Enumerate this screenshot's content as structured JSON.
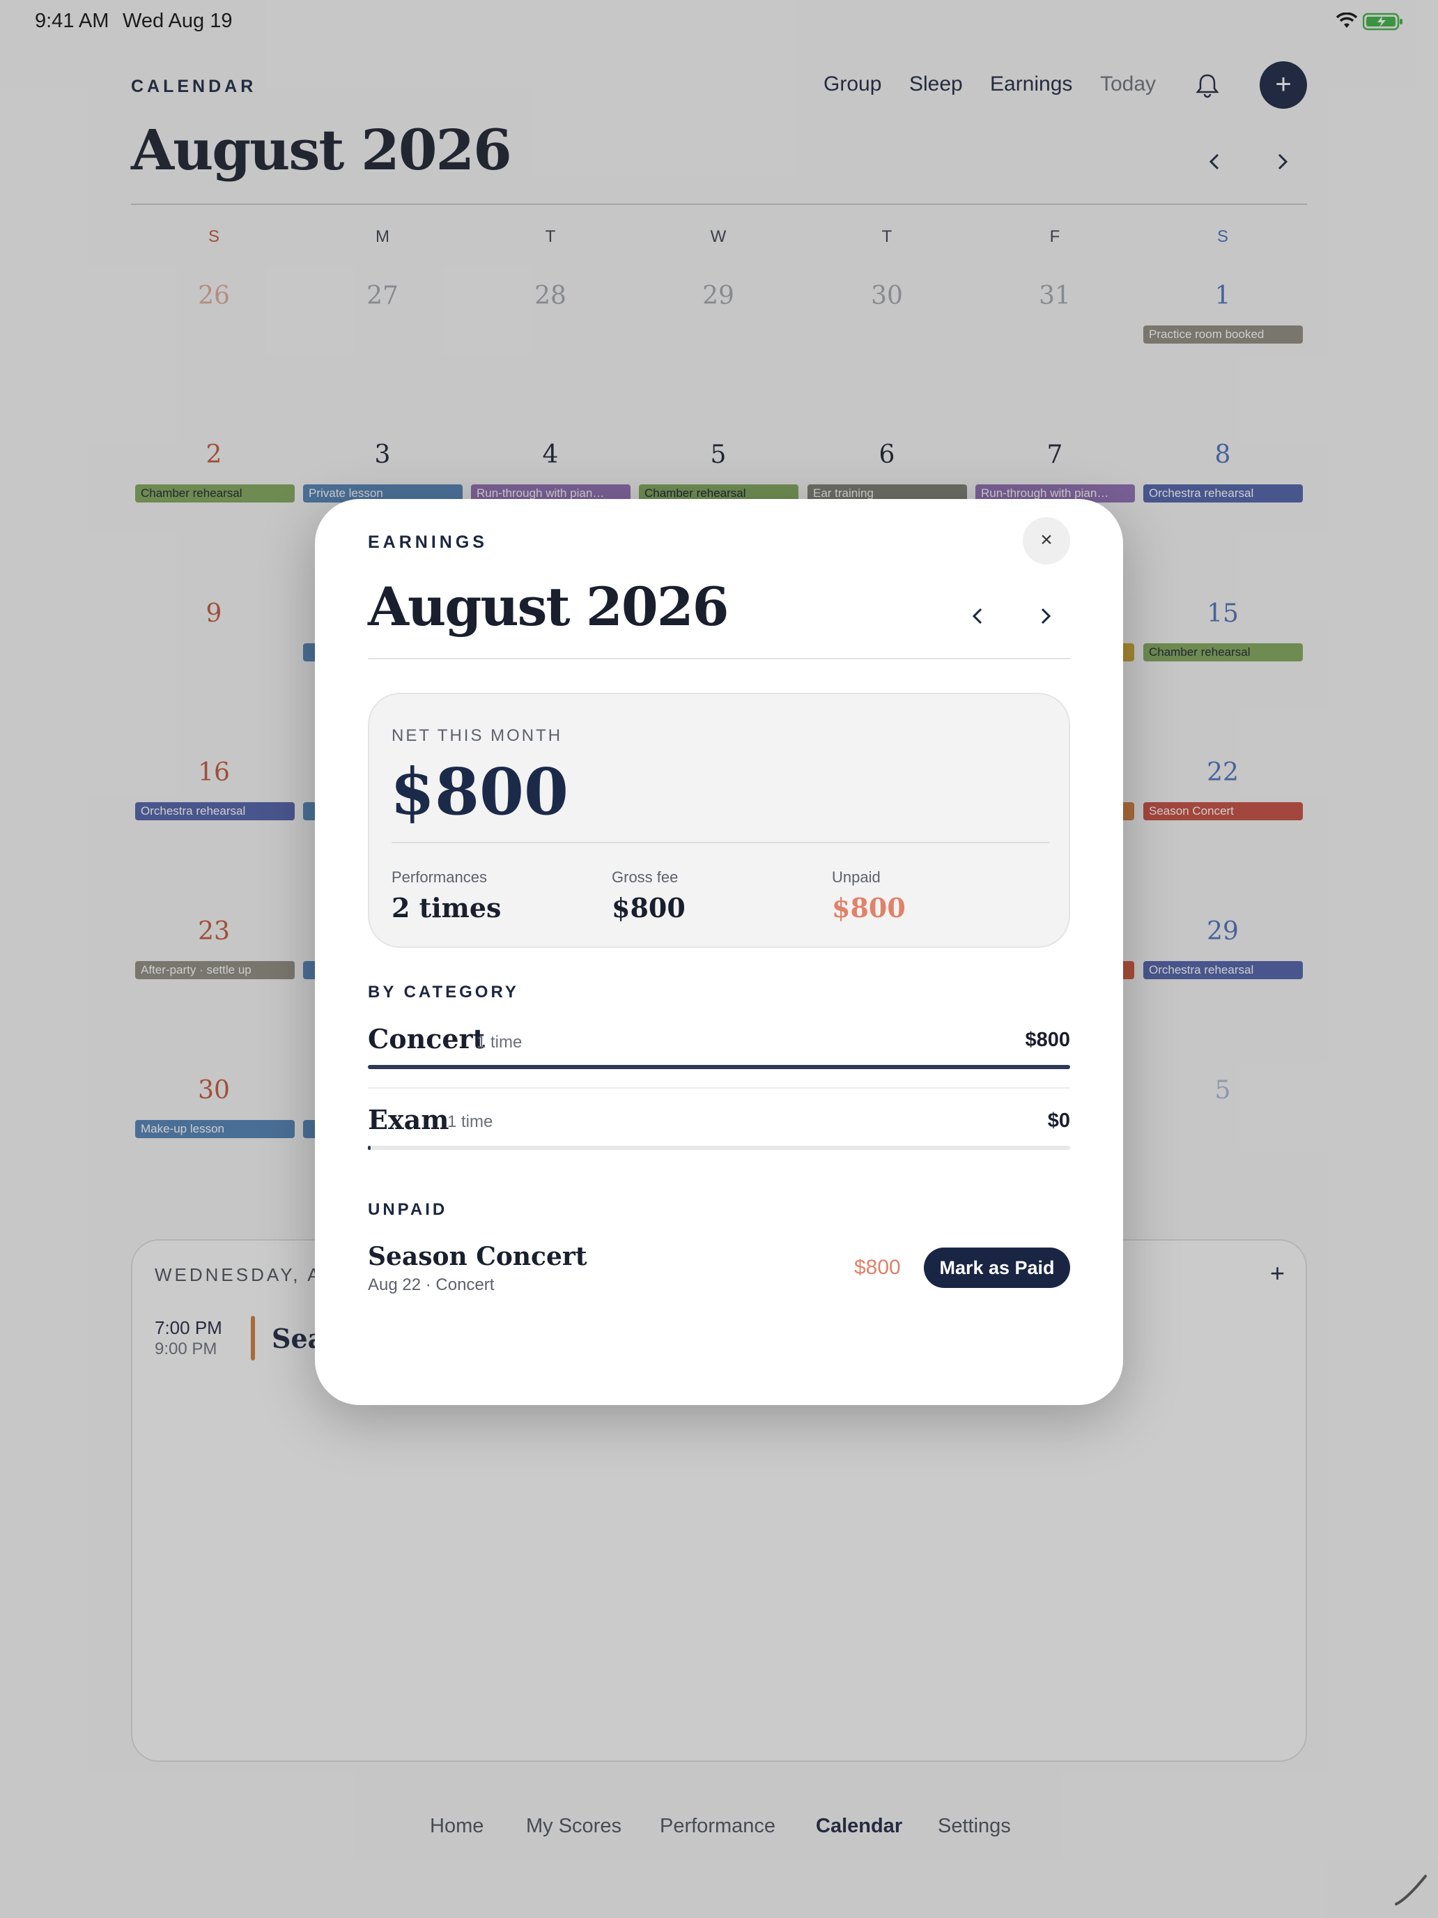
{
  "status": {
    "time": "9:41 AM",
    "date": "Wed Aug 19"
  },
  "header": {
    "brand": "CALENDAR",
    "nav": [
      "Group",
      "Sleep",
      "Earnings",
      "Today"
    ],
    "add_label": "+",
    "title": "August 2026"
  },
  "calendar": {
    "weekdays": [
      "S",
      "M",
      "T",
      "W",
      "T",
      "F",
      "S"
    ],
    "weeks": [
      [
        "26",
        "27",
        "28",
        "29",
        "30",
        "31",
        "1"
      ],
      [
        "2",
        "3",
        "4",
        "5",
        "6",
        "7",
        "8"
      ],
      [
        "9",
        "",
        "",
        "",
        "",
        "",
        "15"
      ],
      [
        "16",
        "",
        "",
        "",
        "",
        "",
        "22"
      ],
      [
        "23",
        "",
        "",
        "",
        "",
        "",
        "29"
      ],
      [
        "30",
        "",
        "",
        "",
        "",
        "",
        "5"
      ]
    ],
    "events": [
      {
        "label": "Practice room booked",
        "color": "#8c8a7e"
      },
      {
        "label": "Chamber rehearsal",
        "color": "#7fa65a"
      },
      {
        "label": "Private lesson",
        "color": "#4f80b5"
      },
      {
        "label": "Run-through with pian…",
        "color": "#8e6bb2"
      },
      {
        "label": "Chamber rehearsal",
        "color": "#7fa65a"
      },
      {
        "label": "Ear training",
        "color": "#7a7d70"
      },
      {
        "label": "Run-through with pian…",
        "color": "#8e6bb2"
      },
      {
        "label": "Orchestra rehearsal",
        "color": "#4e5fa8"
      },
      {
        "label": "Chamber rehearsal",
        "color": "#7fa65a"
      },
      {
        "label": "Orchestra rehearsal",
        "color": "#4e5fa8"
      },
      {
        "label": "Season Concert",
        "color": "#c64a3e"
      },
      {
        "label": "After-party · settle up",
        "color": "#8c8a7e"
      },
      {
        "label": "Orchestra rehearsal",
        "color": "#4e5fa8"
      },
      {
        "label": "Make-up lesson",
        "color": "#4f80b5"
      }
    ]
  },
  "day_panel": {
    "header": "WEDNESDAY, AU",
    "add_label": "+",
    "start": "7:00 PM",
    "end": "9:00 PM",
    "title": "Sea"
  },
  "tabs": [
    "Home",
    "My Scores",
    "Performance",
    "Calendar",
    "Settings"
  ],
  "modal": {
    "label": "EARNINGS",
    "close": "×",
    "title": "August 2026",
    "net_label": "NET THIS MONTH",
    "net_amount": "$800",
    "stats": [
      {
        "label": "Performances",
        "value": "2 times"
      },
      {
        "label": "Gross fee",
        "value": "$800"
      },
      {
        "label": "Unpaid",
        "value": "$800"
      }
    ],
    "by_category_label": "BY CATEGORY",
    "categories": [
      {
        "name": "Concert",
        "count": "1 time",
        "amount": "$800",
        "share": 1.0
      },
      {
        "name": "Exam",
        "count": "1 time",
        "amount": "$0",
        "share": 0.0
      }
    ],
    "unpaid_label": "UNPAID",
    "unpaid_items": [
      {
        "title": "Season Concert",
        "subtitle": "Aug 22 · Concert",
        "amount": "$800",
        "button": "Mark as Paid"
      }
    ]
  }
}
